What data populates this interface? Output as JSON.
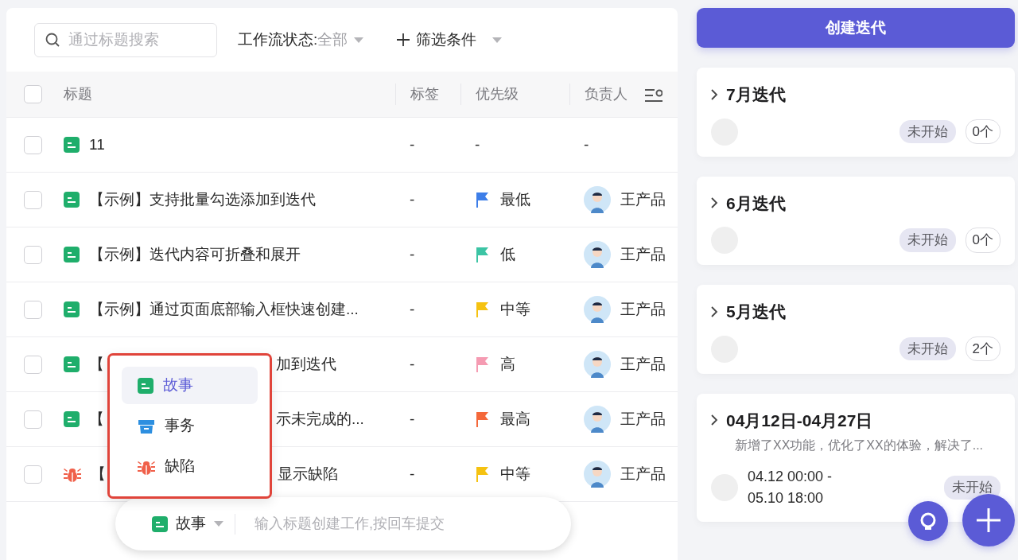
{
  "toolbar": {
    "search": {
      "placeholder": "通过标题搜索"
    },
    "status_filter": {
      "label": "工作流状态:",
      "value": "全部"
    },
    "add_filter": {
      "label": "筛选条件"
    }
  },
  "table": {
    "select_all": {
      "checked": false
    },
    "columns": [
      "标题",
      "标签",
      "优先级",
      "负责人"
    ],
    "rows": [
      {
        "kind": "story",
        "checked": false,
        "title": "11",
        "tag": "-",
        "priority": {
          "label": "-"
        },
        "assignee": {
          "name": "-",
          "avatar": false
        }
      },
      {
        "kind": "story",
        "checked": false,
        "title": "【示例】支持批量勾选添加到迭代",
        "tag": "-",
        "priority": {
          "label": "最低",
          "color": "#3d7ee8"
        },
        "assignee": {
          "name": "王产品",
          "avatar": true
        }
      },
      {
        "kind": "story",
        "checked": false,
        "title": "【示例】迭代内容可折叠和展开",
        "tag": "-",
        "priority": {
          "label": "低",
          "color": "#3cc4a4"
        },
        "assignee": {
          "name": "王产品",
          "avatar": true
        }
      },
      {
        "kind": "story",
        "checked": false,
        "title": "【示例】通过页面底部输入框快速创建...",
        "tag": "-",
        "priority": {
          "label": "中等",
          "color": "#f5c211"
        },
        "assignee": {
          "name": "王产品",
          "avatar": true
        }
      },
      {
        "kind": "story",
        "checked": false,
        "title_parts": [
          "【",
          "加到迭代"
        ],
        "tag": "-",
        "priority": {
          "label": "高",
          "color": "#f59bb2"
        },
        "assignee": {
          "name": "王产品",
          "avatar": true
        }
      },
      {
        "kind": "story",
        "checked": false,
        "title_parts": [
          "【",
          "示未完成的..."
        ],
        "tag": "-",
        "priority": {
          "label": "最高",
          "color": "#f4683a"
        },
        "assignee": {
          "name": "王产品",
          "avatar": true
        }
      },
      {
        "kind": "bug",
        "checked": false,
        "title_parts": [
          "【",
          "显示缺陷"
        ],
        "tag": "-",
        "priority": {
          "label": "中等",
          "color": "#f5c211"
        },
        "assignee": {
          "name": "王产品",
          "avatar": true
        }
      }
    ]
  },
  "type_menu": {
    "items": [
      {
        "kind": "story",
        "label": "故事",
        "selected": true
      },
      {
        "kind": "task",
        "label": "事务",
        "selected": false
      },
      {
        "kind": "bug",
        "label": "缺陷",
        "selected": false
      }
    ]
  },
  "quick_create": {
    "type": {
      "kind": "story",
      "label": "故事"
    },
    "placeholder": "输入标题创建工作,按回车提交"
  },
  "create_button": "创建迭代",
  "iterations": [
    {
      "title": "7月迭代",
      "status": "未开始",
      "count": "0个"
    },
    {
      "title": "6月迭代",
      "status": "未开始",
      "count": "0个"
    },
    {
      "title": "5月迭代",
      "status": "未开始",
      "count": "2个"
    },
    {
      "title": "04月12日-04月27日",
      "description": "新增了XX功能，优化了XX的体验，解决了...",
      "date_range": "04.12 00:00 -\n05.10 18:00",
      "status": "未开始"
    }
  ]
}
